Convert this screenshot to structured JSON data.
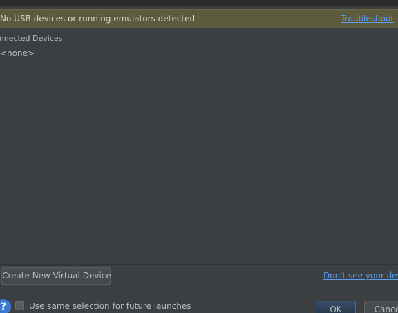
{
  "banner": {
    "message": "No USB devices or running emulators detected",
    "link": "Troubleshoot"
  },
  "devices": {
    "group_title": "onnected Devices",
    "empty_item": "<none>"
  },
  "actions": {
    "create_button": "Create New Virtual Device",
    "help_link": "Don't see your devic"
  },
  "footer": {
    "help_icon": "?",
    "checkbox_label": "Use same selection for future launches",
    "checkbox_checked": false,
    "ok_label": "OK",
    "cancel_label": "Cancel"
  },
  "colors": {
    "background": "#3c3f41",
    "banner": "#5c5b3d",
    "link": "#589df6",
    "help_icon": "#3e7ad4",
    "ok_button": "#2c3e55"
  }
}
